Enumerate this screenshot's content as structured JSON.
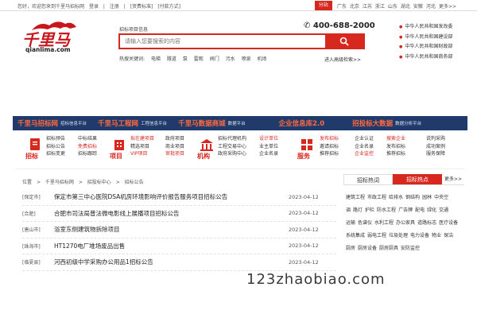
{
  "topbar": {
    "welcome": "您好，欢迎您来到千里马招标网",
    "login": "登录",
    "sep1": "|",
    "register": "注册",
    "sep2": "|",
    "fees": "[资费标准]",
    "payment": "[付款方式]",
    "branch": "分站",
    "cities": [
      "广东",
      "北京",
      "江苏",
      "浙江",
      "山东",
      "湖北",
      "安徽",
      "河北",
      "更多>>"
    ]
  },
  "logo": {
    "text": "千里马",
    "domain": "qianlima.com"
  },
  "search": {
    "label": "招标项目信息",
    "placeholder": "请输入您要搜索的内容",
    "hot_label": "热搜关键词:",
    "hot_words": [
      "电梯",
      "隧道",
      "泵",
      "雷观",
      "阀门",
      "污水",
      "喷泉",
      "机场"
    ],
    "advanced": "进入高级检索>>"
  },
  "phone": "400-688-2000",
  "gov_links": [
    "中华人民共和国发改委",
    "中华人民共和国建设部",
    "中华人民共和国财政部",
    "中华人民共和国商务部"
  ],
  "navbar": [
    {
      "title": "千里马招标网",
      "sub": "招标信息平台"
    },
    {
      "title": "千里马工程网",
      "sub": "工程信息平台"
    },
    {
      "title": "千里马数据商城",
      "sub": "数据平台"
    },
    {
      "title": "企业信息库2.0",
      "sub": ""
    },
    {
      "title": "招投标大数据",
      "sub": "数据分析平台"
    }
  ],
  "categories": [
    {
      "title": "招标",
      "col1": [
        "招标预告",
        "招标公告",
        "招标变更"
      ],
      "col2": [
        "中标结果",
        "免费招标",
        "招标跟踪"
      ]
    },
    {
      "title": "项目",
      "col1": [
        "拟在建项目",
        "精选项目",
        "VIP项目"
      ],
      "col2": [
        "政府项目",
        "商业项目",
        "审批项目"
      ]
    },
    {
      "title": "机构",
      "col1": [
        "招标代理机构",
        "工程交易中心",
        "政府采购中心"
      ],
      "col2": [
        "设计单位",
        "业主单位",
        "企业名录"
      ]
    },
    {
      "title": "服务",
      "col1": [
        "发布招标",
        "邀请招标",
        "推荐招标"
      ],
      "col2": [
        "企业认证",
        "企业名录",
        "企业监控"
      ]
    },
    {
      "title": "",
      "col1": [
        "搜索企业",
        "发布招标",
        "推荐招标"
      ],
      "col2": [
        "说判采购",
        "成功案例",
        "服务保障"
      ]
    }
  ],
  "breadcrumb": [
    "位置",
    ">",
    "千里马招标网",
    ">",
    "招投标中心",
    ">",
    "招标公告"
  ],
  "listings": [
    {
      "tag": "[保定市]",
      "title": "保定市第三中心医院DSA机房环境影响评价报告服务项目招标公告",
      "date": "2023-04-12"
    },
    {
      "tag": "[合肥]",
      "title": "合肥市司法局普法微电影线上展播项目招标公告",
      "date": "2023-04-12"
    },
    {
      "tag": "[唐山市]",
      "title": "浴室东侧建筑物拆除项目",
      "date": "2023-04-12"
    },
    {
      "tag": "[珠海市]",
      "title": "HT1270电厂堆场废品出售",
      "date": "2023-04-12"
    },
    {
      "tag": "[临夏县]",
      "title": "河西初级中学采购办公用品1招标公告",
      "date": "2023-04-12"
    }
  ],
  "sidebar": {
    "tab1": "招标热词",
    "tab2": "招标热点",
    "more": "更多>>",
    "keywords": [
      "建筑工程",
      "市政工程",
      "给排水",
      "钢结构",
      "园林",
      "中央空",
      "调",
      "路灯",
      "护栏",
      "防水工程",
      "广告牌",
      "配电",
      "绿化",
      "交通",
      "运输",
      "色谱仪",
      "水利工程",
      "办公家具",
      "道路标志",
      "医疗设备",
      "系统集成",
      "弱电工程",
      "垃圾处理",
      "电力设备",
      "物业",
      "保洁",
      "厨房",
      "厨房设备",
      "厨房厨具",
      "安防监控"
    ]
  },
  "watermark": "123zhaobiao.com"
}
